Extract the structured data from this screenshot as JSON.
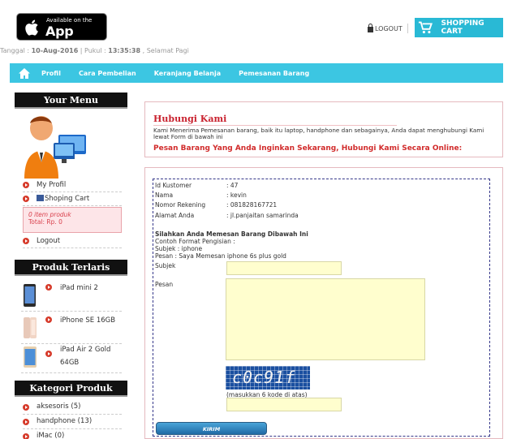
{
  "header": {
    "appstore_small": "Available on the",
    "appstore_big": "App Store",
    "date_label": "Tanggal : ",
    "date_value": "10-Aug-2016",
    "time_label": " | Pukul : ",
    "time_value": "13:35:38",
    "greeting": " , Selamat Pagi",
    "logout": "LOGOUT",
    "cart_button": "SHOPPING CART"
  },
  "nav": {
    "items": [
      "Profil",
      "Cara Pembelian",
      "Keranjang Belanja",
      "Pemesanan Barang"
    ]
  },
  "sidebar": {
    "menu_title": "Your Menu",
    "menu_items": [
      "My Profil",
      "Shoping Cart",
      "Logout"
    ],
    "cart_items": "0 item produk",
    "cart_total": "Total: Rp. 0",
    "bestseller_title": "Produk Terlaris",
    "products": [
      "iPad mini 2",
      "iPhone SE 16GB",
      "iPad Air 2 Gold 64GB"
    ],
    "category_title": "Kategori Produk",
    "categories": [
      "aksesoris (5)",
      "handphone (13)",
      "iMac (0)"
    ]
  },
  "contact": {
    "title": "Hubungi Kami",
    "description": "Kami Menerima Pemesanan barang, baik itu laptop, handphone dan sebagainya, Anda dapat menghubungi Kami lewat Form di bawah ini",
    "call_to_action": "Pesan Barang Yang Anda Inginkan Sekarang, Hubungi Kami Secara Online:"
  },
  "form": {
    "customer": [
      {
        "label": "Id Kustomer",
        "value": ": 47"
      },
      {
        "label": "Nama",
        "value": ": kevin"
      },
      {
        "label": "Nomor Rekening",
        "value": ": 081828167721"
      },
      {
        "label": "Alamat Anda",
        "value": ": jl.panjaitan samarinda"
      }
    ],
    "instruction_title": "Silahkan Anda Memesan Barang Dibawah Ini",
    "example_title": "Contoh Format Pengisian :",
    "example_subject": "Subjek : iphone",
    "example_message": "Pesan : Saya Memesan iphone 6s plus gold",
    "subject_label": "Subjek",
    "subject_value": "",
    "message_label": "Pesan",
    "message_value": "",
    "captcha_code": "c0c91f",
    "captcha_hint": "(masukkan 6 kode di atas)",
    "captcha_value": "",
    "submit_label": "KIRIM"
  }
}
